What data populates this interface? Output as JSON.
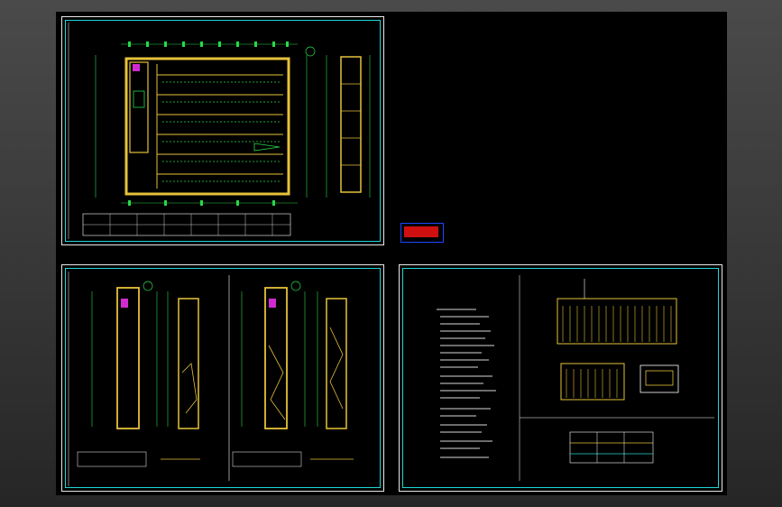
{
  "window": {
    "title": ""
  },
  "stamp": {
    "label": ""
  },
  "sheets": [
    {
      "id": "sheet-1",
      "name": "floor-plan-and-section"
    },
    {
      "id": "sheet-2",
      "name": "stair-plans"
    },
    {
      "id": "sheet-3",
      "name": "notes-and-diagrams"
    }
  ],
  "colors": {
    "background": "#000000",
    "sheet_border": "#e8e8e8",
    "inner_border": "#1fd6d6",
    "walls": "#e6c23a",
    "annotations": "#27d94a",
    "text": "#ffffff",
    "highlight": "#d12ad1"
  }
}
